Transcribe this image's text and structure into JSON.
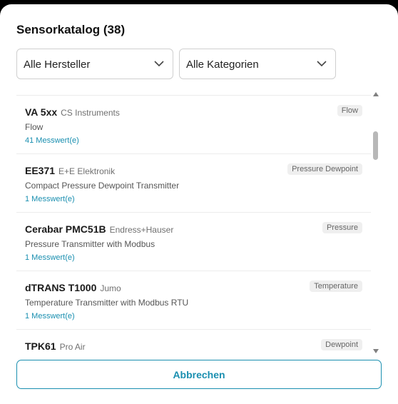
{
  "dialog": {
    "title": "Sensorkatalog (38)"
  },
  "filters": {
    "manufacturer": "Alle Hersteller",
    "category": "Alle Kategorien"
  },
  "sensors": [
    {
      "name": "VA 5xx",
      "manufacturer": "CS Instruments",
      "description": "Flow",
      "count": "41 Messwert(e)",
      "badge": "Flow"
    },
    {
      "name": "EE371",
      "manufacturer": "E+E Elektronik",
      "description": "Compact Pressure Dewpoint Transmitter",
      "count": "1 Messwert(e)",
      "badge": "Pressure Dewpoint"
    },
    {
      "name": "Cerabar PMC51B",
      "manufacturer": "Endress+Hauser",
      "description": "Pressure Transmitter with Modbus",
      "count": "1 Messwert(e)",
      "badge": "Pressure"
    },
    {
      "name": "dTRANS T1000",
      "manufacturer": "Jumo",
      "description": "Temperature Transmitter with Modbus RTU",
      "count": "1 Messwert(e)",
      "badge": "Temperature"
    },
    {
      "name": "TPK61",
      "manufacturer": "Pro Air",
      "description": "",
      "count": "",
      "badge": "Dewpoint"
    }
  ],
  "footer": {
    "cancel_label": "Abbrechen"
  },
  "colors": {
    "accent": "#1a8fb0",
    "border": "#cfcfcf",
    "badge_bg": "#efefef"
  },
  "icons": {
    "select_arrow": "chevron-down-icon",
    "scroll_up": "scroll-up-arrow-icon",
    "scroll_down": "scroll-down-arrow-icon"
  }
}
